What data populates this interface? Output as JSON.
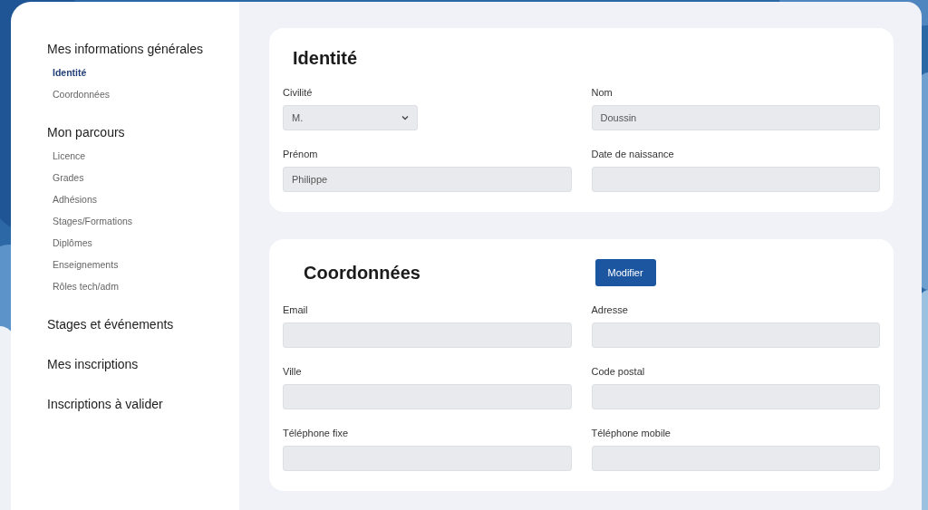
{
  "sidebar": {
    "sections": [
      {
        "title": "Mes informations générales",
        "items": [
          {
            "label": "Identité",
            "selected": true
          },
          {
            "label": "Coordonnées",
            "selected": false
          }
        ]
      },
      {
        "title": "Mon parcours",
        "items": [
          {
            "label": "Licence",
            "selected": false
          },
          {
            "label": "Grades",
            "selected": false
          },
          {
            "label": "Adhésions",
            "selected": false
          },
          {
            "label": "Stages/Formations",
            "selected": false
          },
          {
            "label": "Diplômes",
            "selected": false
          },
          {
            "label": "Enseignements",
            "selected": false
          },
          {
            "label": "Rôles tech/adm",
            "selected": false
          }
        ]
      },
      {
        "title": "Stages et événements"
      },
      {
        "title": "Mes inscriptions"
      },
      {
        "title": "Inscriptions à valider"
      }
    ]
  },
  "cards": [
    {
      "title": "Identité",
      "fields": [
        {
          "label": "Civilité",
          "kind": "select",
          "value": "M."
        },
        {
          "label": "Nom",
          "kind": "text",
          "value": "Doussin"
        },
        {
          "label": "Prénom",
          "kind": "text",
          "value": "Philippe"
        },
        {
          "label": "Date de naissance",
          "kind": "text"
        }
      ]
    },
    {
      "title": "Coordonnées",
      "button": "Modifier",
      "fields": [
        {
          "label": "Email",
          "kind": "text"
        },
        {
          "label": "Adresse",
          "kind": "text"
        },
        {
          "label": "Ville",
          "kind": "text"
        },
        {
          "label": "Code postal",
          "kind": "text"
        },
        {
          "label": "Téléphone fixe",
          "kind": "text"
        },
        {
          "label": "Téléphone mobile",
          "kind": "text"
        }
      ]
    }
  ]
}
